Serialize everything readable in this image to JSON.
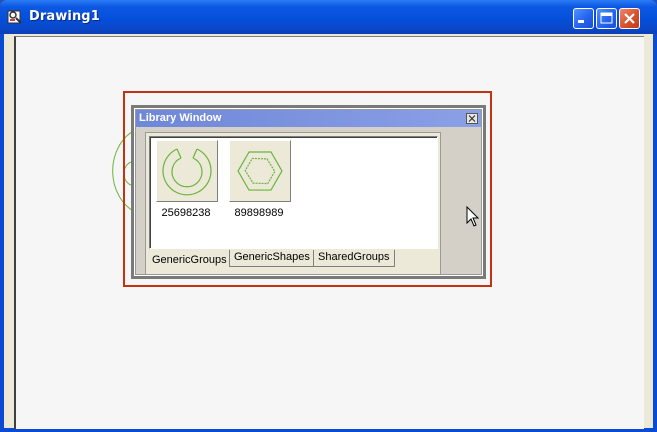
{
  "window": {
    "title": "Drawing1",
    "icon": "app-drawing-icon",
    "controls": [
      "minimize-icon",
      "maximize-icon",
      "close-icon"
    ]
  },
  "library_window": {
    "title": "Library Window",
    "items": [
      {
        "label": "25698238",
        "icon": "ring-shape-icon"
      },
      {
        "label": "89898989",
        "icon": "hexagon-shape-icon"
      }
    ],
    "tabs": [
      {
        "label": "GenericGroups",
        "active": true
      },
      {
        "label": "GenericShapes",
        "active": false
      },
      {
        "label": "SharedGroups",
        "active": false
      }
    ]
  },
  "colors": {
    "selection_outline": "#c33212",
    "shape_stroke": "#6ab43c",
    "library_titlebar": "#7a92dc"
  }
}
